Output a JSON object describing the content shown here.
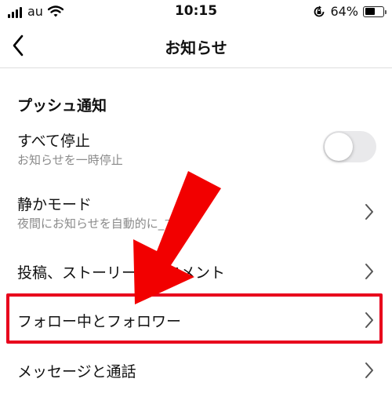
{
  "status_bar": {
    "carrier": "au",
    "time": "10:15",
    "battery_percent": "64%",
    "battery_level": 0.64
  },
  "nav": {
    "title": "お知らせ",
    "back_icon": "chevron-left-icon"
  },
  "push_section": {
    "title": "プッシュ通知",
    "pause_all": {
      "label": "すべて停止",
      "sublabel": "お知らせを一時停止",
      "toggle_on": false
    },
    "quiet_mode": {
      "label": "静かモード",
      "sublabel": "夜間にお知らせを自動的に_する"
    },
    "posts": {
      "label": "投稿、ストーリーズ、コメント"
    },
    "following": {
      "label": "フォロー中とフォロワー"
    },
    "messages": {
      "label": "メッセージと通話"
    }
  },
  "annotation": {
    "highlight_color": "#e8001c",
    "arrow_color": "#f20000"
  }
}
